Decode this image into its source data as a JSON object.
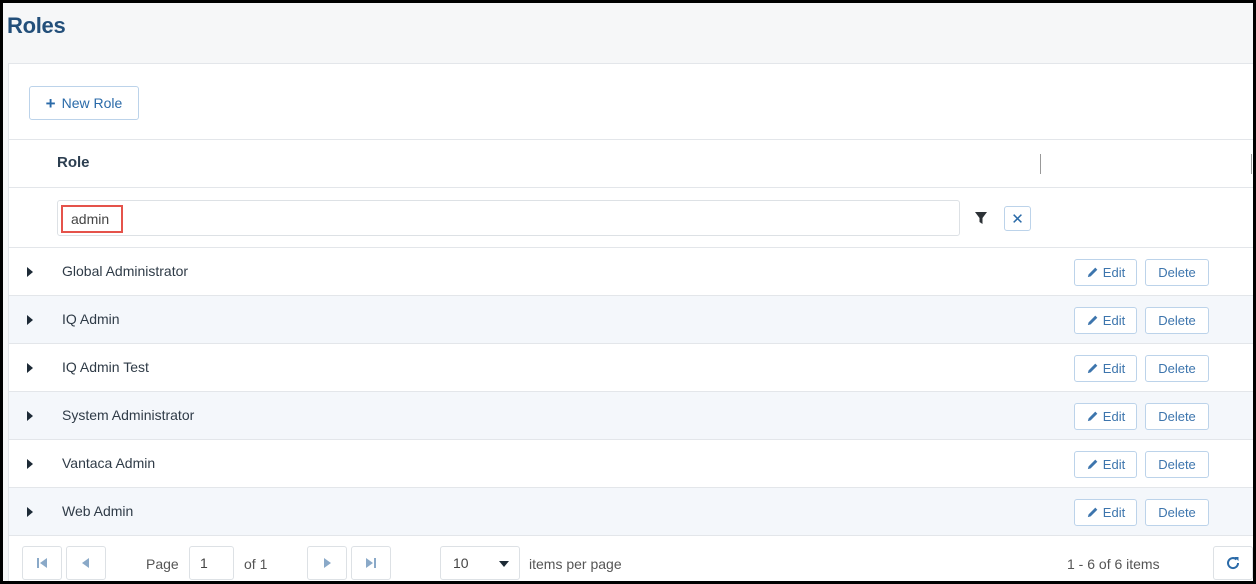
{
  "page": {
    "title": "Roles"
  },
  "toolbar": {
    "new_role_label": "New Role"
  },
  "grid": {
    "column_header": "Role",
    "filter": {
      "value": "admin"
    },
    "rows": [
      {
        "label": "Global Administrator"
      },
      {
        "label": "IQ Admin"
      },
      {
        "label": "IQ Admin Test"
      },
      {
        "label": "System Administrator"
      },
      {
        "label": "Vantaca Admin"
      },
      {
        "label": "Web Admin"
      }
    ],
    "row_actions": {
      "edit_label": "Edit",
      "delete_label": "Delete"
    }
  },
  "pager": {
    "page_label": "Page",
    "current_page": "1",
    "of_label": "of 1",
    "page_size": "10",
    "items_per_page_label": "items per page",
    "summary": "1 - 6 of 6 items"
  },
  "colors": {
    "title": "#234f7a",
    "accent": "#2a6aa8",
    "highlight_border": "#e5534b",
    "row_alt": "#f4f7fb"
  }
}
